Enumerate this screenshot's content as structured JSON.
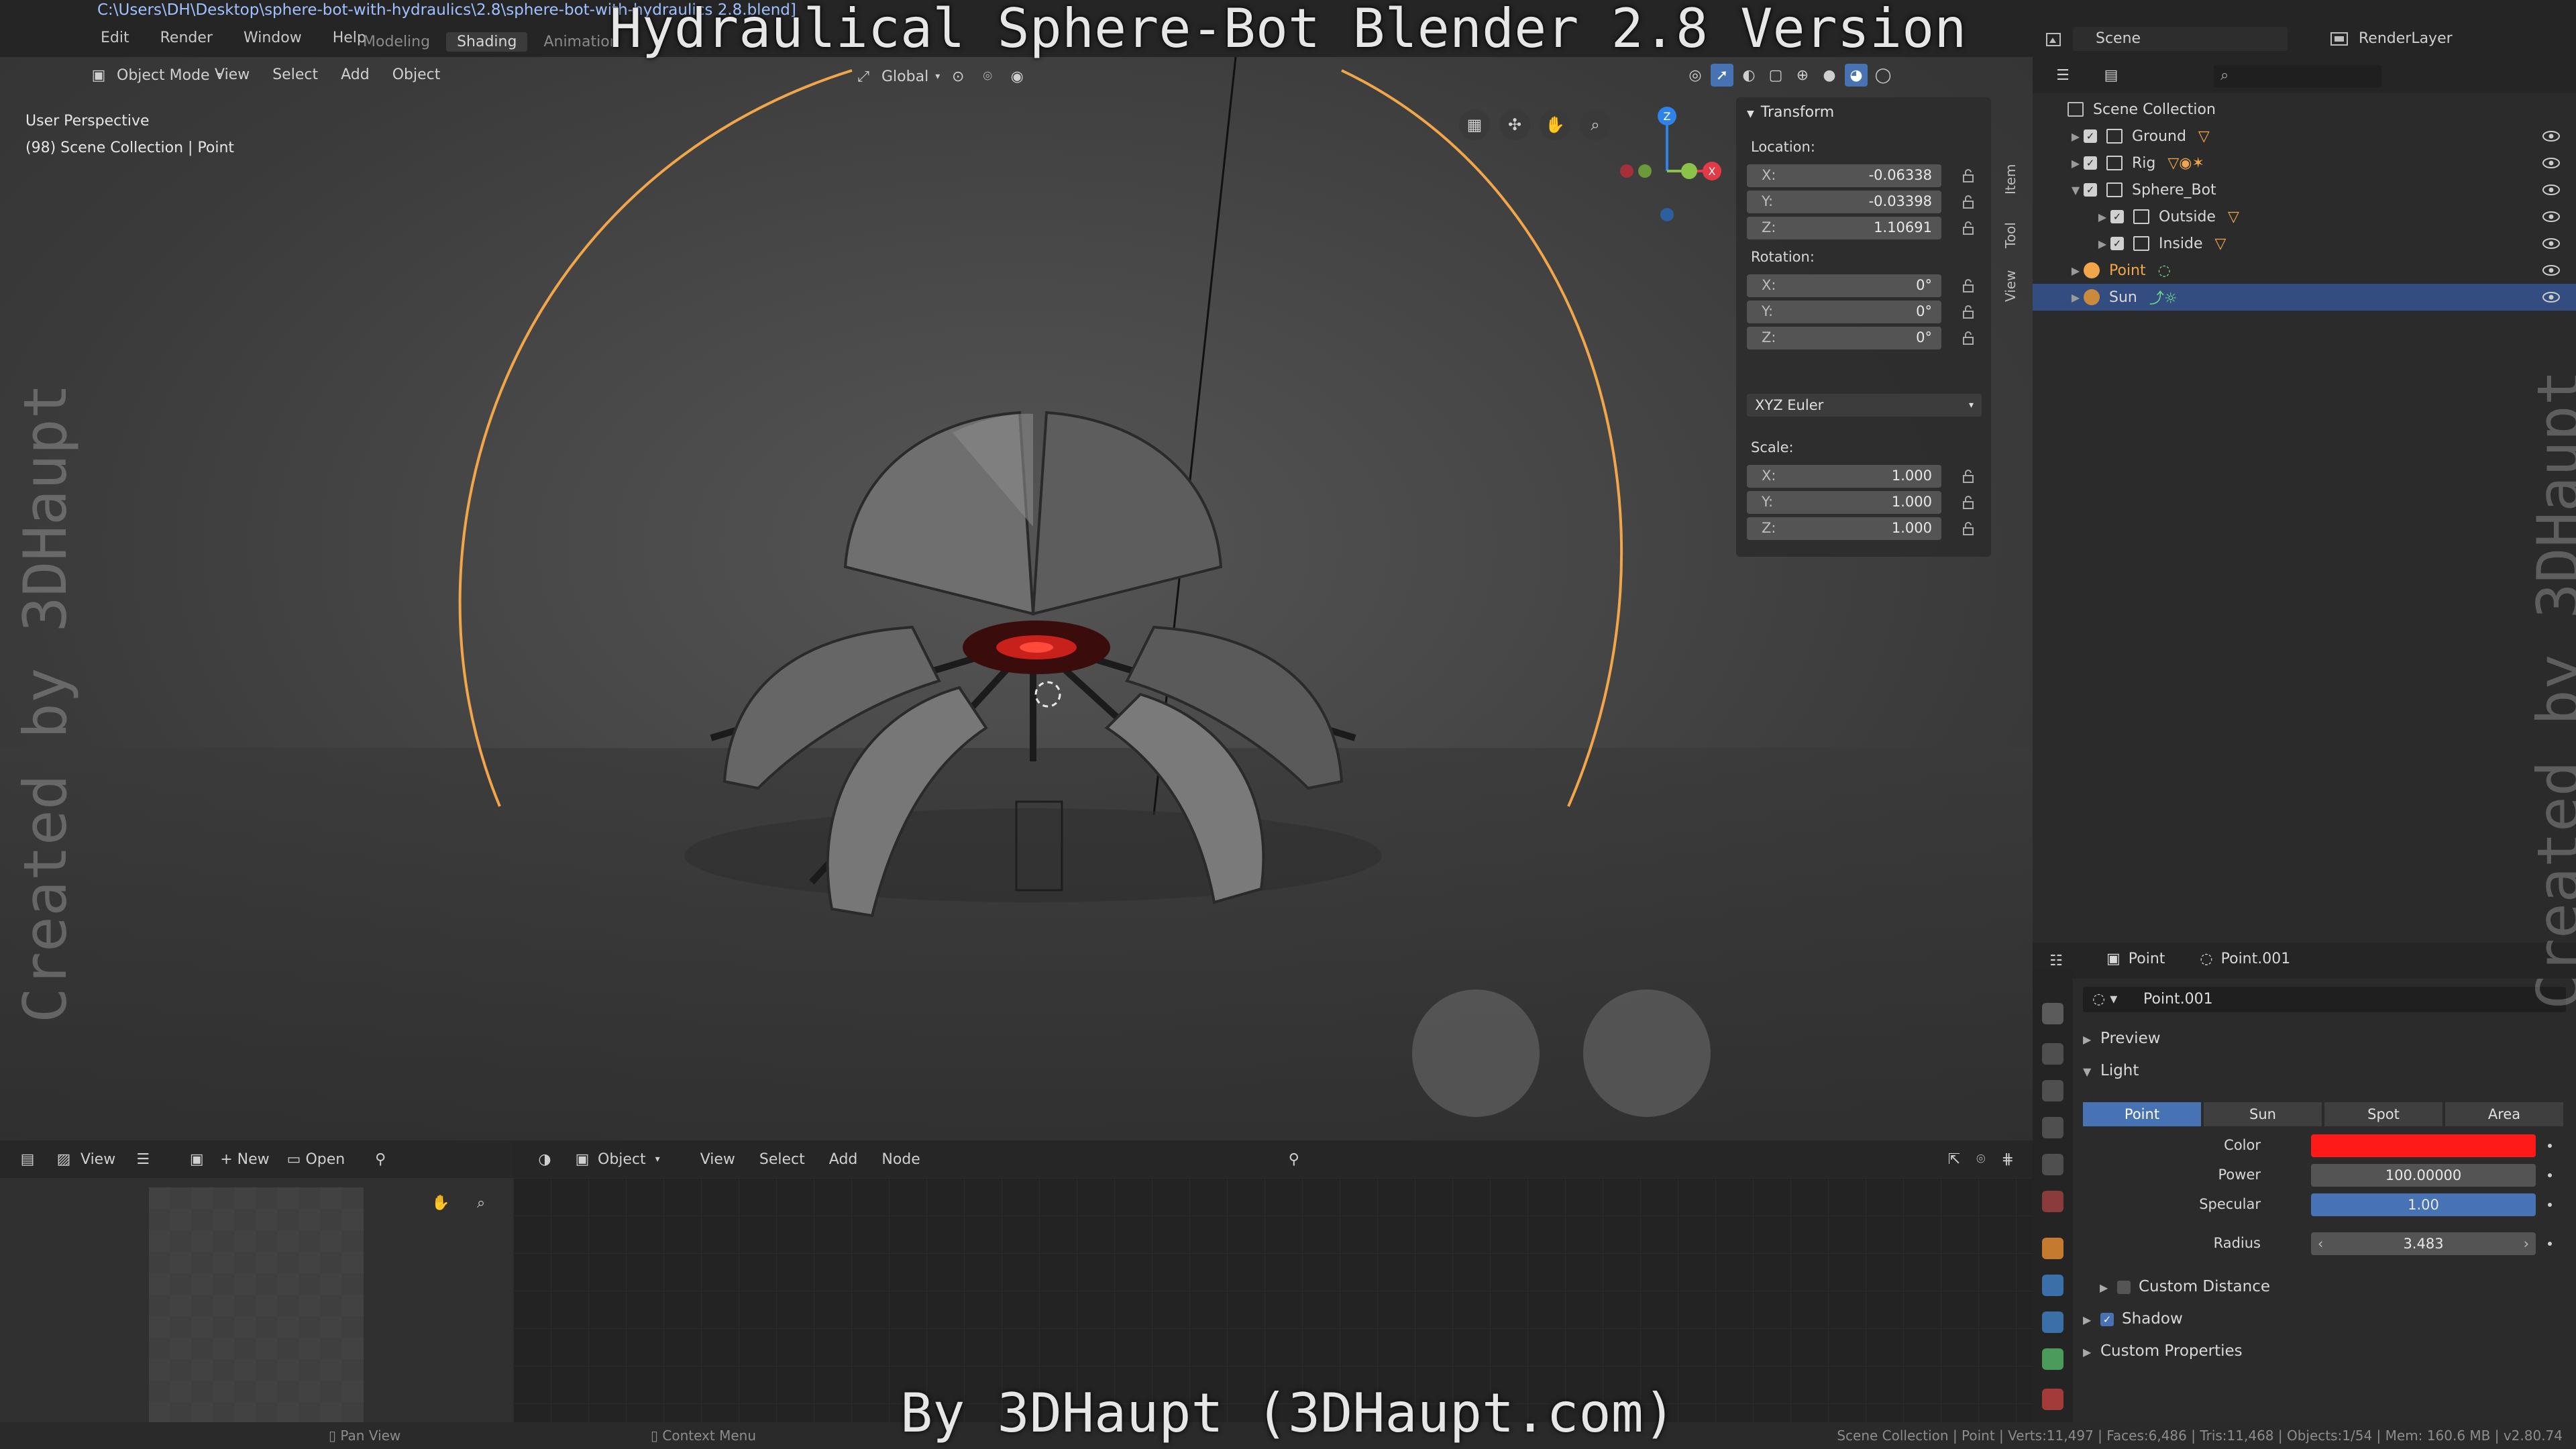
{
  "title_overlay": "Hydraulical Sphere-Bot Blender 2.8 Version",
  "credit_overlay": "By 3DHaupt (3DHaupt.com)",
  "watermark": "Created by 3DHaupt",
  "file_path": "C:\\Users\\DH\\Desktop\\sphere-bot-with-hydraulics\\2.8\\sphere-bot-with-hydraulics 2.8.blend]",
  "top_menu": [
    "Edit",
    "Render",
    "Window",
    "Help"
  ],
  "workspace_tabs": [
    "Modeling",
    "Shading",
    "Animation"
  ],
  "scene_name": "Scene",
  "render_layer": "RenderLayer",
  "viewport": {
    "mode": "Object Mode",
    "menus": [
      "View",
      "Select",
      "Add",
      "Object"
    ],
    "orientation": "Global",
    "overlay_line1": "User Perspective",
    "overlay_line2": "(98) Scene Collection | Point",
    "gizmo_axes": {
      "z": "Z",
      "x": "X",
      "z_color": "#2f83e8",
      "x_color": "#e23a46",
      "y_color": "#8bc34a"
    },
    "side_tabs": [
      "Item",
      "Tool",
      "View"
    ]
  },
  "transform_panel": {
    "title": "Transform",
    "location_label": "Location:",
    "location": [
      {
        "axis": "X:",
        "value": "-0.06338"
      },
      {
        "axis": "Y:",
        "value": "-0.03398"
      },
      {
        "axis": "Z:",
        "value": "1.10691"
      }
    ],
    "rotation_label": "Rotation:",
    "rotation": [
      {
        "axis": "X:",
        "value": "0°"
      },
      {
        "axis": "Y:",
        "value": "0°"
      },
      {
        "axis": "Z:",
        "value": "0°"
      }
    ],
    "rotation_mode": "XYZ Euler",
    "scale_label": "Scale:",
    "scale": [
      {
        "axis": "X:",
        "value": "1.000"
      },
      {
        "axis": "Y:",
        "value": "1.000"
      },
      {
        "axis": "Z:",
        "value": "1.000"
      }
    ]
  },
  "image_editor": {
    "view_label": "View",
    "new_label": "New",
    "open_label": "Open"
  },
  "node_editor": {
    "object_label": "Object",
    "menus": [
      "View",
      "Select",
      "Add",
      "Node"
    ]
  },
  "statusbar": {
    "left": "Pan View",
    "middle": "Context Menu",
    "right": "Scene Collection | Point | Verts:11,497 | Faces:6,486 | Tris:11,468 | Objects:1/54 | Mem: 160.6 MB | v2.80.74"
  },
  "outliner": {
    "root": "Scene Collection",
    "items": [
      {
        "name": "Ground",
        "type": "collection"
      },
      {
        "name": "Rig",
        "type": "collection"
      },
      {
        "name": "Sphere_Bot",
        "type": "collection"
      },
      {
        "name": "Outside",
        "type": "collection"
      },
      {
        "name": "Inside",
        "type": "collection"
      },
      {
        "name": "Point",
        "type": "light"
      },
      {
        "name": "Sun",
        "type": "light"
      }
    ]
  },
  "properties": {
    "object_name": "Point",
    "data_name": "Point.001",
    "datablock": "Point.001",
    "sections": {
      "preview": "Preview",
      "light": "Light",
      "custom_distance": "Custom Distance",
      "shadow": "Shadow",
      "custom_properties": "Custom Properties"
    },
    "light_types": [
      "Point",
      "Sun",
      "Spot",
      "Area"
    ],
    "active_light_type": "Point",
    "color_label": "Color",
    "color_value": "#ff1a1a",
    "power_label": "Power",
    "power_value": "100.00000",
    "specular_label": "Specular",
    "specular_value": "1.00",
    "radius_label": "Radius",
    "radius_value": "3.483"
  }
}
